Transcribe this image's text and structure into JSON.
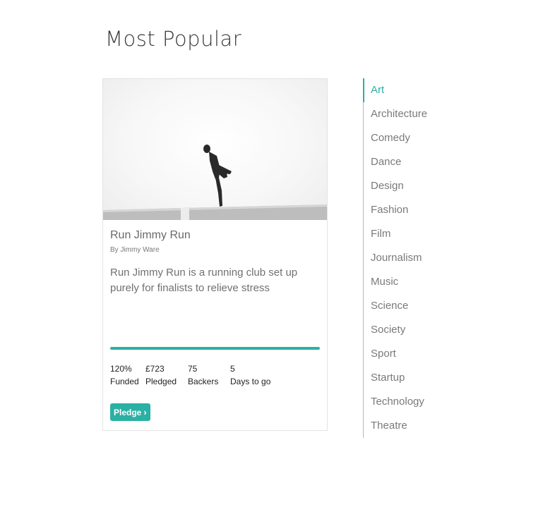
{
  "section": {
    "title": "Most Popular"
  },
  "project": {
    "title": "Run Jimmy Run",
    "author": "By Jimmy Ware",
    "description": "Run Jimmy Run is a running club set up purely for finalists to relieve stress",
    "progress_fraction": 1.0,
    "stats": [
      {
        "value": "120%",
        "label": "Funded"
      },
      {
        "value": "£723",
        "label": "Pledged"
      },
      {
        "value": "75",
        "label": "Backers"
      },
      {
        "value": "5",
        "label": "Days to go"
      }
    ],
    "pledge_label": "Pledge",
    "pledge_icon": "chevron-right-icon"
  },
  "categories": {
    "active_index": 0,
    "items": [
      "Art",
      "Architecture",
      "Comedy",
      "Dance",
      "Design",
      "Fashion",
      "Film",
      "Journalism",
      "Music",
      "Science",
      "Society",
      "Sport",
      "Startup",
      "Technology",
      "Theatre"
    ]
  },
  "colors": {
    "accent": "#2bb0a4",
    "muted_text": "#7a7a7a",
    "nav_line": "#b8b8b8"
  }
}
